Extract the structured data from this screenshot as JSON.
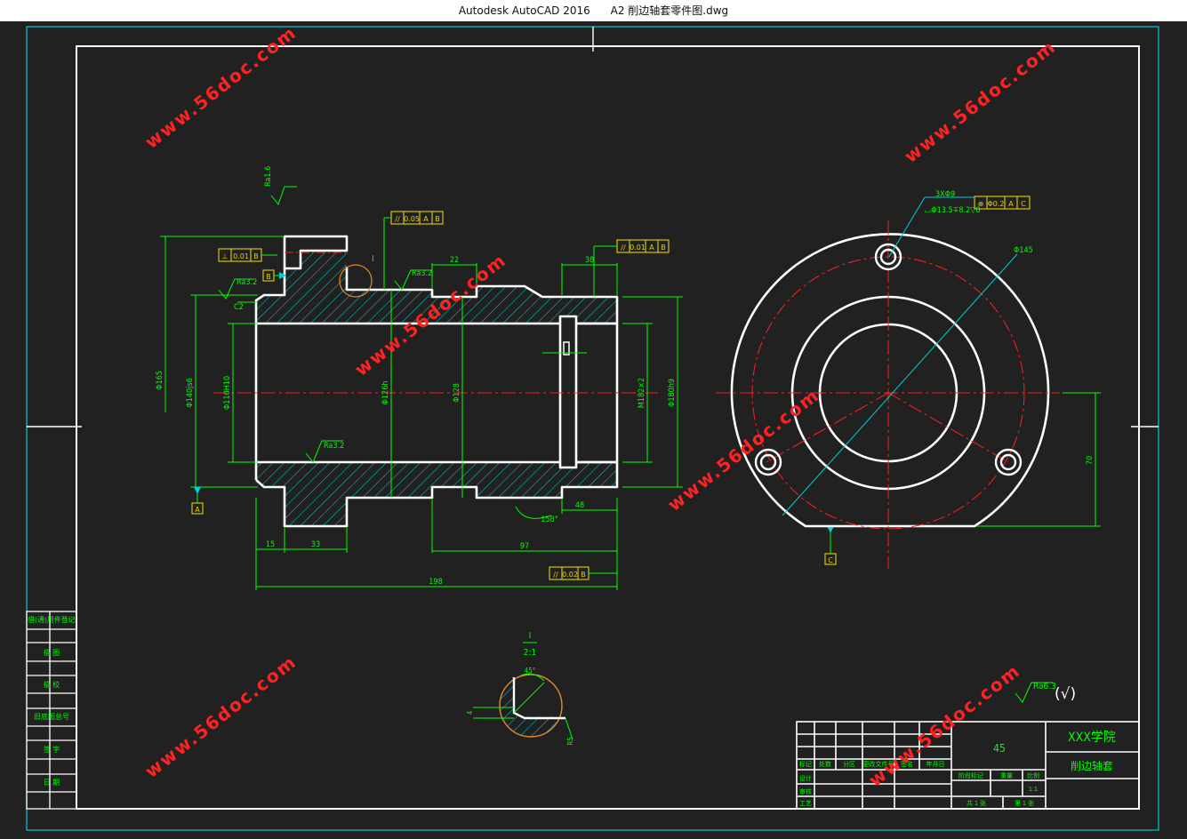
{
  "window": {
    "title_app": "Autodesk AutoCAD 2016",
    "title_file": "A2 削边轴套零件图.dwg"
  },
  "colors": {
    "background": "#212121",
    "frame_cyan": "#00c8d2",
    "outline_white": "#ffffff",
    "dimension_green": "#00ff00",
    "hatch_cyan": "#00cfd6",
    "tolerance_yellow": "#e8d100",
    "centerline_red": "#ff2020",
    "watermark_red": "#ff2222"
  },
  "watermark": {
    "text": "www.56doc.com"
  },
  "drawing": {
    "dims": {
      "d165": "Φ165",
      "d140js6": "Φ140js6",
      "d110h10": "Φ110H10",
      "d126h": "Φ126h",
      "d128": "Φ128",
      "m182": "M182×2",
      "d180h9": "Φ180h9",
      "len15": "15",
      "len33": "33",
      "len97": "97",
      "len198": "198",
      "len22": "22",
      "len38": "38",
      "len48": "48",
      "ang158": "158°",
      "chamfer_c2": "C2",
      "pcd145": "Φ145",
      "holes": "3XΦ9",
      "cbore": "⌴Φ13.5∓8.2▽8",
      "v70": "70",
      "detail_angle": "45°",
      "detail_4": "4",
      "detail_r5": "R5"
    },
    "roughness": {
      "ra16": "Ra1.6",
      "ra32_a": "Ra3.2",
      "ra32_b": "Ra3.2",
      "ra32_c": "Ra3.2",
      "ra63": "Ra6.3",
      "general": "(√)"
    },
    "tolerances": {
      "t1_sym": "∕∕",
      "t1_val": "0.05",
      "t1_ref": "A",
      "t1_ref2": "B",
      "t2_sym": "∕∕",
      "t2_val": "0.01",
      "t2_ref": "A",
      "t2_ref2": "B",
      "t3_sym": "⊥",
      "t3_val": "0.01",
      "t3_ref": "B",
      "t4_sym": "∕∕",
      "t4_val": "0.02",
      "t4_ref": "B",
      "t5_sym": "⊕",
      "t5_val": "Φ0.2",
      "t5_ref": "A",
      "t5_ref2": "C"
    },
    "datums": {
      "a": "A",
      "b": "B",
      "c": "C"
    },
    "detail": {
      "label": "I",
      "scale": "2:1",
      "callout": "I"
    }
  },
  "side_table": {
    "rows": [
      "借(通)用件登记",
      "描 图",
      "描 校",
      "旧底图总号",
      "签 字",
      "日 期"
    ]
  },
  "title_block": {
    "school": "XXX学院",
    "part_name": "削边轴套",
    "material": "45",
    "scale": "1:1",
    "sheet": "第 1 张",
    "sheets": "共 1 张",
    "headers": [
      "标记",
      "处数",
      "分区",
      "更改文件号",
      "签名",
      "年月日"
    ],
    "roles": [
      "设计",
      "审核",
      "工艺"
    ],
    "stage_headers": [
      "阶段标记",
      "重量",
      "比例"
    ]
  }
}
